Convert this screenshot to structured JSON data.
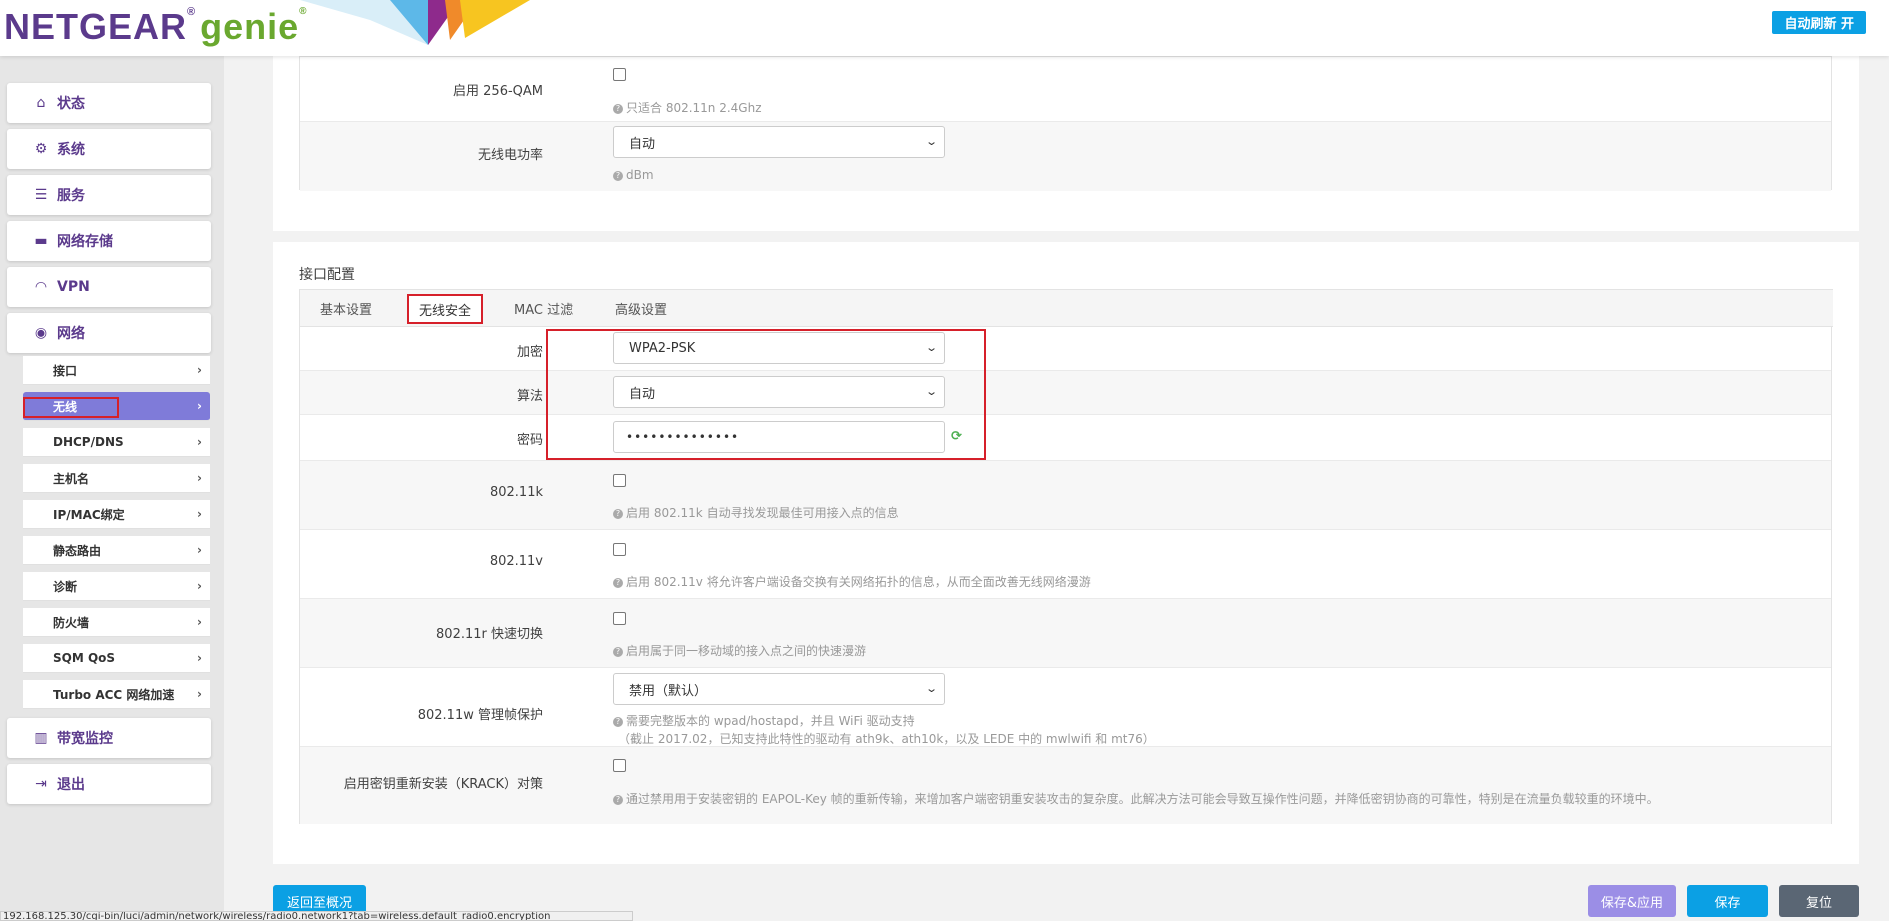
{
  "header": {
    "brand_main": "NETGEAR",
    "brand_reg": "®",
    "brand_genie": "genie",
    "brand_genie_reg": "®",
    "auto_refresh": "自动刷新 开"
  },
  "sidebar": {
    "main_items": [
      {
        "label": "状态",
        "icon": "home-icon"
      },
      {
        "label": "系统",
        "icon": "gears-icon"
      },
      {
        "label": "服务",
        "icon": "list-icon"
      },
      {
        "label": "网络存储",
        "icon": "drive-icon"
      },
      {
        "label": "VPN",
        "icon": "gauge-icon"
      },
      {
        "label": "网络",
        "icon": "globe-icon"
      }
    ],
    "sub_items": [
      {
        "label": "接口"
      },
      {
        "label": "无线"
      },
      {
        "label": "DHCP/DNS"
      },
      {
        "label": "主机名"
      },
      {
        "label": "IP/MAC绑定"
      },
      {
        "label": "静态路由"
      },
      {
        "label": "诊断"
      },
      {
        "label": "防火墙"
      },
      {
        "label": "SQM QoS"
      },
      {
        "label": "Turbo ACC 网络加速"
      }
    ],
    "bottom_items": [
      {
        "label": "带宽监控",
        "icon": "bar-chart-icon"
      },
      {
        "label": "退出",
        "icon": "sign-out-icon"
      }
    ]
  },
  "top_panel": {
    "qam_label": "启用 256-QAM",
    "qam_hint": "只适合 802.11n 2.4Ghz",
    "power_label": "无线电功率",
    "power_value": "自动",
    "power_hint": "dBm"
  },
  "iface": {
    "title": "接口配置",
    "tabs": [
      "基本设置",
      "无线安全",
      "MAC 过滤",
      "高级设置"
    ],
    "encrypt_label": "加密",
    "encrypt_value": "WPA2-PSK",
    "cipher_label": "算法",
    "cipher_value": "自动",
    "password_label": "密码",
    "password_value": "••••••••••••••",
    "k_label": "802.11k",
    "k_hint": "启用 802.11k 自动寻找发现最佳可用接入点的信息",
    "v_label": "802.11v",
    "v_hint": "启用 802.11v 将允许客户端设备交换有关网络拓扑的信息，从而全面改善无线网络漫游",
    "r_label": "802.11r 快速切换",
    "r_hint": "启用属于同一移动域的接入点之间的快速漫游",
    "w_label": "802.11w 管理帧保护",
    "w_value": "禁用（默认）",
    "w_hint1": "需要完整版本的 wpad/hostapd，并且 WiFi 驱动支持",
    "w_hint2": "（截止 2017.02，已知支持此特性的驱动有 ath9k、ath10k，以及 LEDE 中的 mwlwifi 和 mt76）",
    "krack_label": "启用密钥重新安装（KRACK）对策",
    "krack_hint": "通过禁用用于安装密钥的 EAPOL-Key 帧的重新传输，来增加客户端密钥重安装攻击的复杂度。此解决方法可能会导致互操作性问题，并降低密钥协商的可靠性，特别是在流量负载较重的环境中。"
  },
  "footer": {
    "back": "返回至概况",
    "save_apply": "保存&应用",
    "save": "保存",
    "reset": "复位"
  },
  "status_url": "192.168.125.30/cgi-bin/luci/admin/network/wireless/radio0.network1?tab=wireless.default_radio0.encryption"
}
